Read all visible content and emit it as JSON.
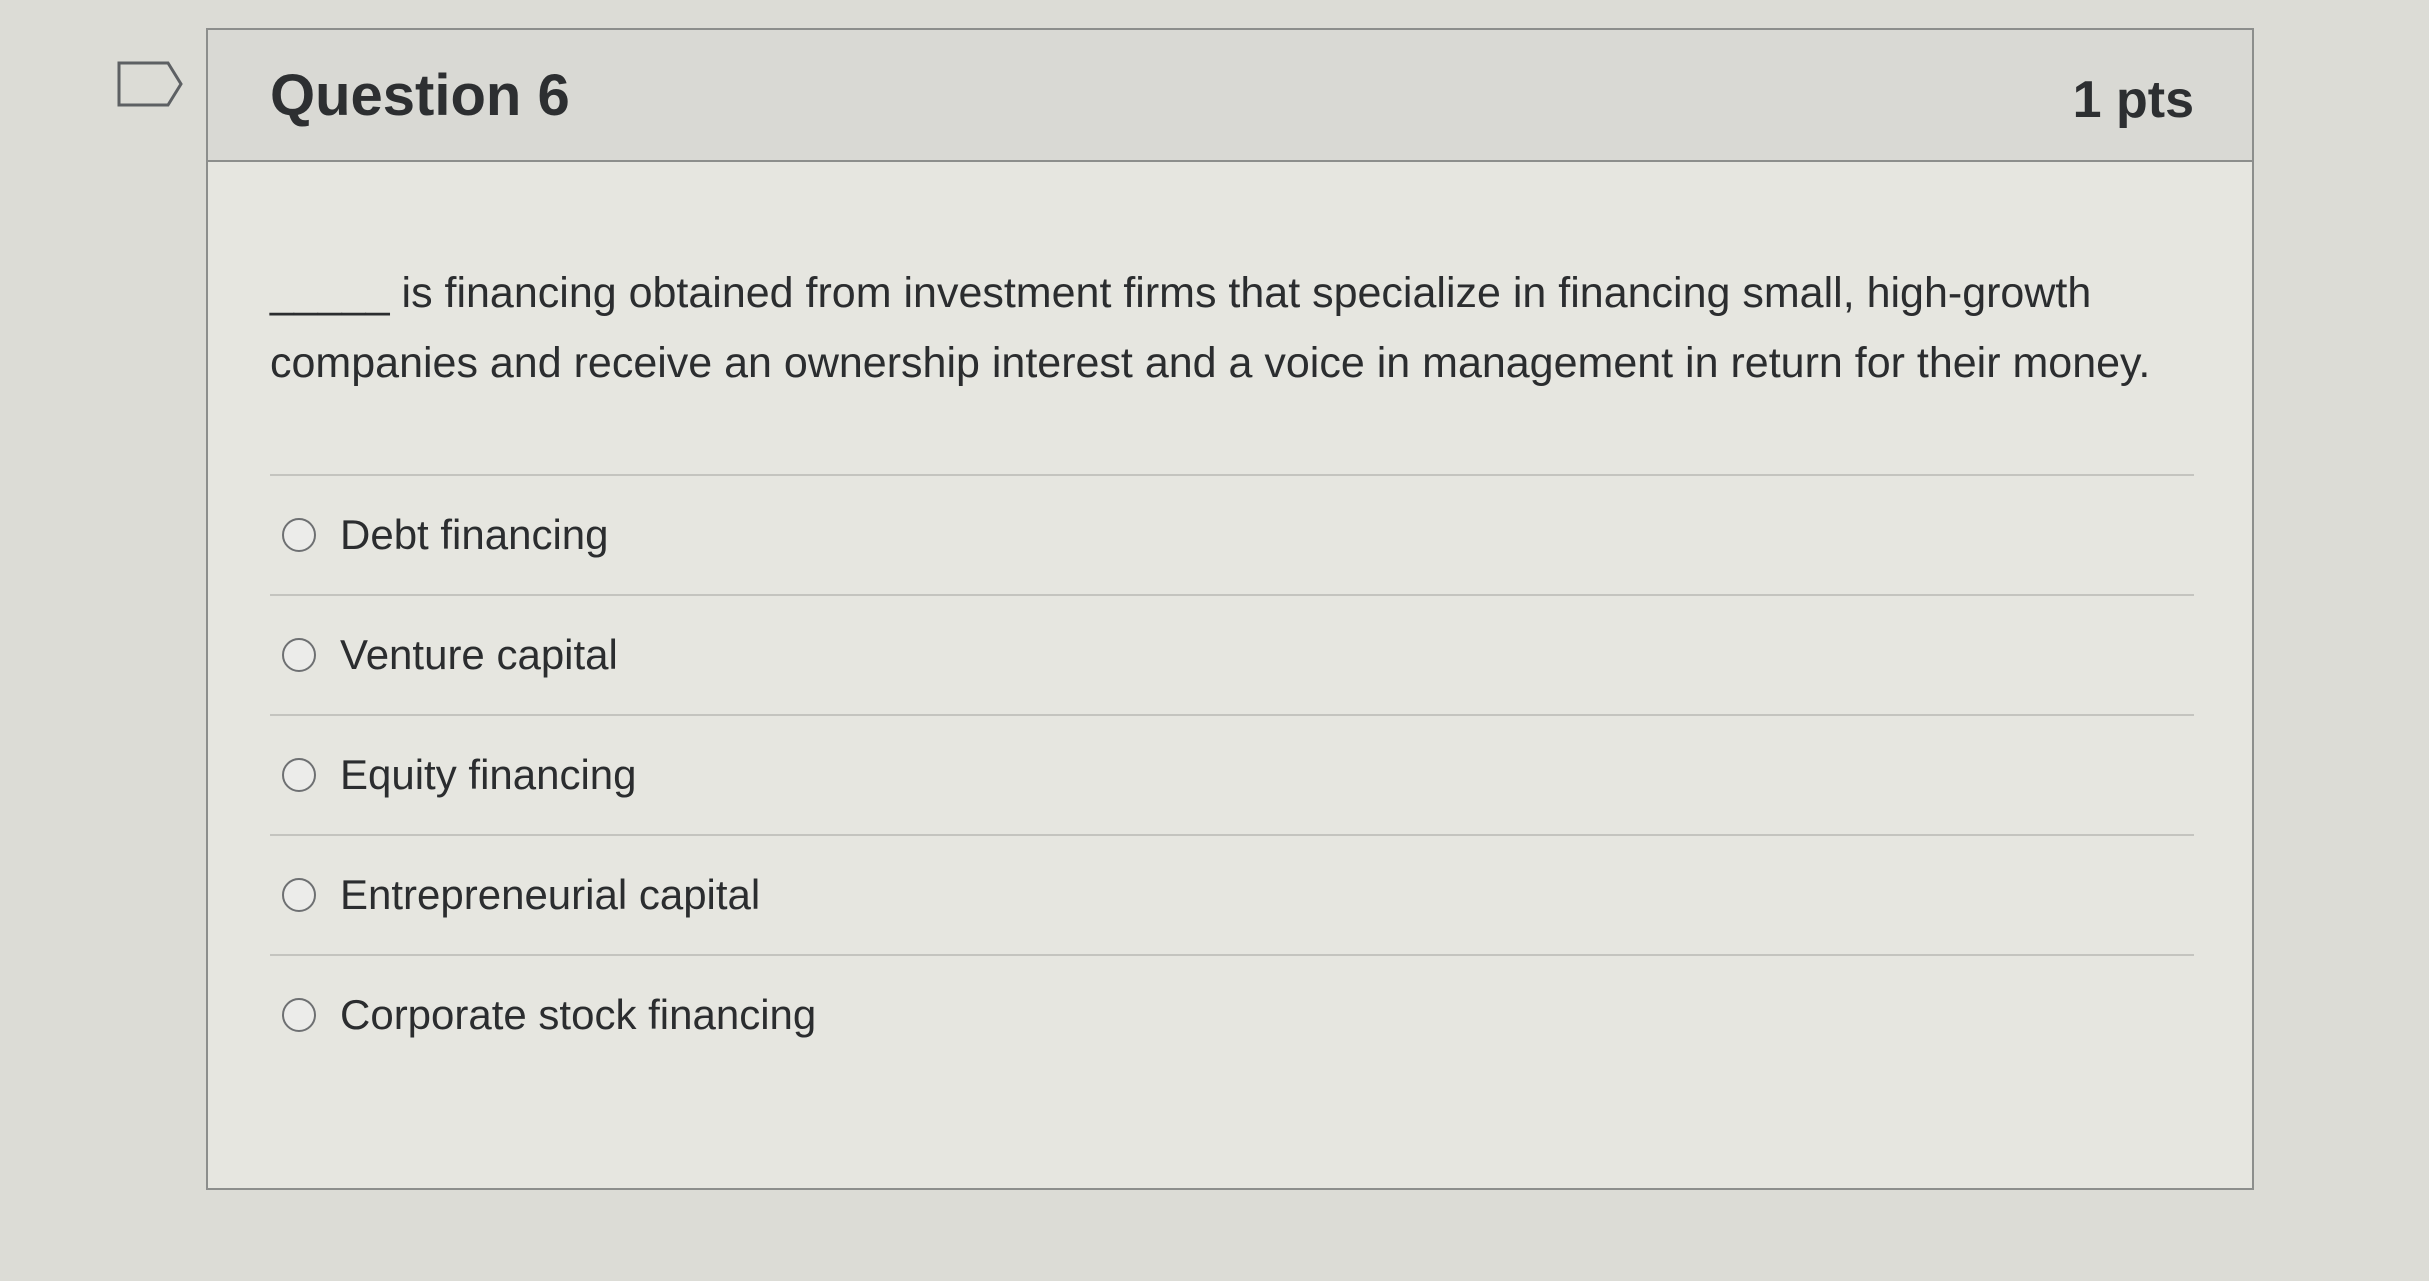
{
  "question": {
    "title": "Question 6",
    "points": "1 pts",
    "text": "_____ is financing obtained from investment firms that specialize in financing small, high-growth companies and receive an ownership interest and a voice in management in return for their money.",
    "answers": [
      {
        "label": "Debt financing",
        "selected": false
      },
      {
        "label": "Venture capital",
        "selected": false
      },
      {
        "label": "Equity financing",
        "selected": false
      },
      {
        "label": "Entrepreneurial capital",
        "selected": false
      },
      {
        "label": "Corporate stock financing",
        "selected": false
      }
    ]
  },
  "icons": {
    "flag": "bookmark-flag-icon"
  },
  "colors": {
    "background": "#dcdcd6",
    "card": "#e6e6e0",
    "header": "#d9d9d4",
    "border": "#8c8e8c",
    "text": "#2b2d2f"
  }
}
